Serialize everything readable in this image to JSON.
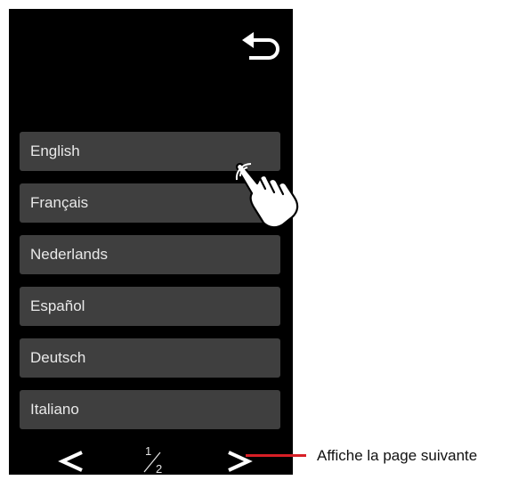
{
  "screen": {
    "back_icon": "back-arrow-icon",
    "languages": [
      {
        "label": "English"
      },
      {
        "label": "Français"
      },
      {
        "label": "Nederlands"
      },
      {
        "label": "Español"
      },
      {
        "label": "Deutsch"
      },
      {
        "label": "Italiano"
      }
    ],
    "pager": {
      "prev_icon": "chevron-left-icon",
      "next_icon": "chevron-right-icon",
      "current_page": "1",
      "total_pages": "2"
    },
    "touch_hint_icon": "pointing-hand-icon"
  },
  "annotation": {
    "text": "Affiche la page suivante",
    "line_color": "#d81f26"
  },
  "colors": {
    "screen_background": "#000000",
    "button_background": "#3f3f3f",
    "text": "#e9e9e9"
  }
}
